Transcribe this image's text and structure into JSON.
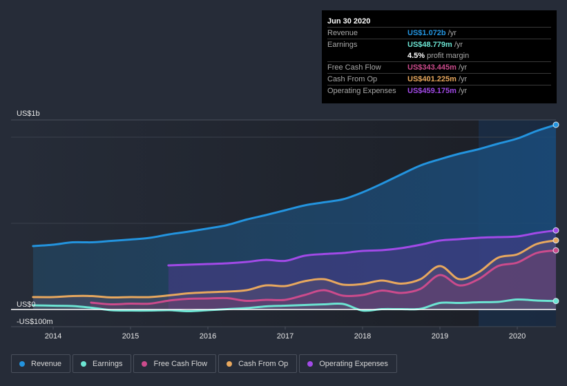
{
  "tooltip": {
    "date": "Jun 30 2020",
    "rows": [
      {
        "label": "Revenue",
        "value": "US$1.072b",
        "unit": "/yr",
        "color": "#2394df"
      },
      {
        "label": "Earnings",
        "value": "US$48.779m",
        "unit": "/yr",
        "color": "#6ce5d3"
      },
      {
        "label": "",
        "value": "4.5%",
        "unit": "profit margin",
        "color": "#ffffff"
      },
      {
        "label": "Free Cash Flow",
        "value": "US$343.445m",
        "unit": "/yr",
        "color": "#cc4b8c"
      },
      {
        "label": "Cash From Op",
        "value": "US$401.225m",
        "unit": "/yr",
        "color": "#e8a85e"
      },
      {
        "label": "Operating Expenses",
        "value": "US$459.175m",
        "unit": "/yr",
        "color": "#a24ae8"
      }
    ]
  },
  "legend": [
    {
      "label": "Revenue",
      "color": "#2394df"
    },
    {
      "label": "Earnings",
      "color": "#6ce5d3"
    },
    {
      "label": "Free Cash Flow",
      "color": "#cc4b8c"
    },
    {
      "label": "Cash From Op",
      "color": "#e8a85e"
    },
    {
      "label": "Operating Expenses",
      "color": "#a24ae8"
    }
  ],
  "chart_data": {
    "type": "area",
    "title": "",
    "xlabel": "",
    "ylabel": "",
    "y_unit": "US$ millions",
    "ylim": [
      -100,
      1100
    ],
    "xlim": [
      2013.49,
      2020.7
    ],
    "y_tick_labels": [
      {
        "value": 1000,
        "label": "US$1b"
      },
      {
        "value": 0,
        "label": "US$0"
      },
      {
        "value": -100,
        "label": "-US$100m"
      }
    ],
    "gridlines": [
      1000,
      500
    ],
    "x_ticks": [
      2014,
      2015,
      2016,
      2017,
      2018,
      2019,
      2020
    ],
    "x_tick_labels": [
      "2014",
      "2015",
      "2016",
      "2017",
      "2018",
      "2019",
      "2020"
    ],
    "highlight_from": 2019.5,
    "series": [
      {
        "name": "Revenue",
        "color": "#2394df",
        "x": [
          2013.74,
          2014.0,
          2014.25,
          2014.5,
          2014.75,
          2015.0,
          2015.25,
          2015.5,
          2015.75,
          2016.0,
          2016.25,
          2016.5,
          2016.75,
          2017.0,
          2017.25,
          2017.5,
          2017.75,
          2018.0,
          2018.25,
          2018.5,
          2018.75,
          2019.0,
          2019.25,
          2019.5,
          2019.75,
          2020.0,
          2020.25,
          2020.5
        ],
        "values": [
          368,
          376,
          390,
          390,
          398,
          406,
          416,
          436,
          452,
          470,
          490,
          522,
          548,
          576,
          604,
          622,
          640,
          680,
          730,
          784,
          836,
          872,
          904,
          930,
          962,
          992,
          1036,
          1072
        ]
      },
      {
        "name": "Operating Expenses",
        "color": "#a24ae8",
        "x": [
          2015.49,
          2015.75,
          2016.0,
          2016.25,
          2016.5,
          2016.75,
          2017.0,
          2017.25,
          2017.5,
          2017.75,
          2018.0,
          2018.25,
          2018.5,
          2018.75,
          2019.0,
          2019.25,
          2019.5,
          2019.75,
          2020.0,
          2020.25,
          2020.5
        ],
        "values": [
          256,
          260,
          264,
          268,
          276,
          288,
          282,
          312,
          322,
          328,
          340,
          344,
          356,
          376,
          400,
          408,
          416,
          420,
          424,
          444,
          459
        ]
      },
      {
        "name": "Cash From Op",
        "color": "#e8a85e",
        "x": [
          2013.74,
          2014.0,
          2014.25,
          2014.5,
          2014.75,
          2015.0,
          2015.25,
          2015.5,
          2015.75,
          2016.0,
          2016.25,
          2016.5,
          2016.75,
          2017.0,
          2017.25,
          2017.5,
          2017.75,
          2018.0,
          2018.25,
          2018.5,
          2018.75,
          2019.0,
          2019.25,
          2019.5,
          2019.75,
          2020.0,
          2020.25,
          2020.5
        ],
        "values": [
          72,
          72,
          78,
          78,
          70,
          72,
          72,
          82,
          94,
          100,
          104,
          112,
          140,
          136,
          164,
          176,
          144,
          148,
          168,
          150,
          176,
          252,
          176,
          216,
          300,
          320,
          380,
          401
        ]
      },
      {
        "name": "Free Cash Flow",
        "color": "#cc4b8c",
        "x": [
          2014.49,
          2014.75,
          2015.0,
          2015.25,
          2015.5,
          2015.75,
          2016.0,
          2016.25,
          2016.5,
          2016.75,
          2017.0,
          2017.25,
          2017.5,
          2017.75,
          2018.0,
          2018.25,
          2018.5,
          2018.75,
          2019.0,
          2019.25,
          2019.5,
          2019.75,
          2020.0,
          2020.25,
          2020.5
        ],
        "values": [
          40,
          30,
          34,
          34,
          52,
          62,
          64,
          66,
          50,
          56,
          56,
          84,
          112,
          80,
          84,
          110,
          96,
          120,
          200,
          140,
          176,
          252,
          272,
          328,
          343
        ]
      },
      {
        "name": "Earnings",
        "color": "#6ce5d3",
        "x": [
          2013.74,
          2014.0,
          2014.25,
          2014.5,
          2014.75,
          2015.0,
          2015.25,
          2015.5,
          2015.75,
          2016.0,
          2016.25,
          2016.5,
          2016.75,
          2017.0,
          2017.25,
          2017.5,
          2017.75,
          2018.0,
          2018.25,
          2018.5,
          2018.75,
          2019.0,
          2019.25,
          2019.5,
          2019.75,
          2020.0,
          2020.25,
          2020.5
        ],
        "values": [
          24,
          22,
          20,
          10,
          -4,
          -6,
          -6,
          -4,
          -10,
          -4,
          2,
          8,
          18,
          22,
          26,
          30,
          32,
          -6,
          2,
          2,
          4,
          38,
          38,
          42,
          44,
          58,
          52,
          49
        ]
      }
    ]
  }
}
